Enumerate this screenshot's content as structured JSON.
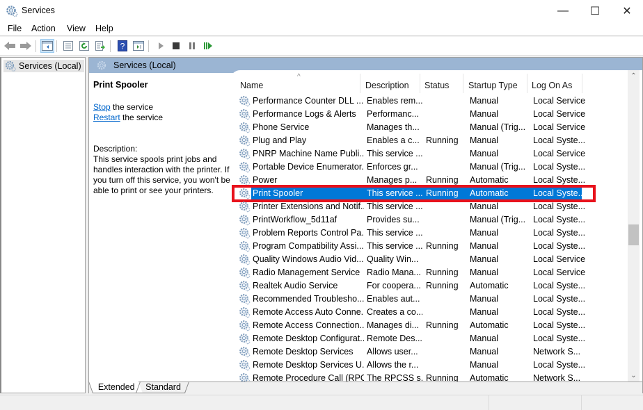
{
  "window": {
    "title": "Services",
    "controls": {
      "minimize": "—",
      "maximize": "☐",
      "close": "✕"
    }
  },
  "menu": [
    "File",
    "Action",
    "View",
    "Help"
  ],
  "toolbar": {
    "icons": [
      "back-icon",
      "forward-icon",
      "show-hide-console-tree-icon",
      "properties-icon",
      "refresh-icon",
      "export-list-icon",
      "help-icon",
      "show-hide-action-pane-icon",
      "start-service-icon",
      "stop-service-icon",
      "pause-service-icon",
      "resume-service-icon"
    ]
  },
  "tree": {
    "root": "Services (Local)"
  },
  "main": {
    "header": "Services (Local)",
    "details": {
      "service_name": "Print Spooler",
      "stop_link": "Stop",
      "stop_suffix": " the service",
      "restart_link": "Restart",
      "restart_suffix": " the service",
      "description_label": "Description:",
      "description": "This service spools print jobs and handles interaction with the printer. If you turn off this service, you won't be able to print or see your printers."
    },
    "columns": [
      "Name",
      "Description",
      "Status",
      "Startup Type",
      "Log On As"
    ],
    "sort_indicator": "^",
    "rows": [
      {
        "name": "Performance Counter DLL ...",
        "description": "Enables rem...",
        "status": "",
        "startup": "Manual",
        "logon": "Local Service"
      },
      {
        "name": "Performance Logs & Alerts",
        "description": "Performanc...",
        "status": "",
        "startup": "Manual",
        "logon": "Local Service"
      },
      {
        "name": "Phone Service",
        "description": "Manages th...",
        "status": "",
        "startup": "Manual (Trig...",
        "logon": "Local Service"
      },
      {
        "name": "Plug and Play",
        "description": "Enables a c...",
        "status": "Running",
        "startup": "Manual",
        "logon": "Local Syste..."
      },
      {
        "name": "PNRP Machine Name Publi...",
        "description": "This service ...",
        "status": "",
        "startup": "Manual",
        "logon": "Local Service"
      },
      {
        "name": "Portable Device Enumerator...",
        "description": "Enforces gr...",
        "status": "",
        "startup": "Manual (Trig...",
        "logon": "Local Syste..."
      },
      {
        "name": "Power",
        "description": "Manages p...",
        "status": "Running",
        "startup": "Automatic",
        "logon": "Local Syste..."
      },
      {
        "name": "Print Spooler",
        "description": "This service ...",
        "status": "Running",
        "startup": "Automatic",
        "logon": "Local Syste...",
        "selected": true
      },
      {
        "name": "Printer Extensions and Notif...",
        "description": "This service ...",
        "status": "",
        "startup": "Manual",
        "logon": "Local Syste..."
      },
      {
        "name": "PrintWorkflow_5d11af",
        "description": "Provides su...",
        "status": "",
        "startup": "Manual (Trig...",
        "logon": "Local Syste..."
      },
      {
        "name": "Problem Reports Control Pa...",
        "description": "This service ...",
        "status": "",
        "startup": "Manual",
        "logon": "Local Syste..."
      },
      {
        "name": "Program Compatibility Assi...",
        "description": "This service ...",
        "status": "Running",
        "startup": "Manual",
        "logon": "Local Syste..."
      },
      {
        "name": "Quality Windows Audio Vid...",
        "description": "Quality Win...",
        "status": "",
        "startup": "Manual",
        "logon": "Local Service"
      },
      {
        "name": "Radio Management Service",
        "description": "Radio Mana...",
        "status": "Running",
        "startup": "Manual",
        "logon": "Local Service"
      },
      {
        "name": "Realtek Audio Service",
        "description": "For coopera...",
        "status": "Running",
        "startup": "Automatic",
        "logon": "Local Syste..."
      },
      {
        "name": "Recommended Troublesho...",
        "description": "Enables aut...",
        "status": "",
        "startup": "Manual",
        "logon": "Local Syste..."
      },
      {
        "name": "Remote Access Auto Conne...",
        "description": "Creates a co...",
        "status": "",
        "startup": "Manual",
        "logon": "Local Syste..."
      },
      {
        "name": "Remote Access Connection...",
        "description": "Manages di...",
        "status": "Running",
        "startup": "Automatic",
        "logon": "Local Syste..."
      },
      {
        "name": "Remote Desktop Configurat...",
        "description": "Remote Des...",
        "status": "",
        "startup": "Manual",
        "logon": "Local Syste..."
      },
      {
        "name": "Remote Desktop Services",
        "description": "Allows user...",
        "status": "",
        "startup": "Manual",
        "logon": "Network S..."
      },
      {
        "name": "Remote Desktop Services U...",
        "description": "Allows the r...",
        "status": "",
        "startup": "Manual",
        "logon": "Local Syste..."
      },
      {
        "name": "Remote Procedure Call (RPC)",
        "description": "The RPCSS s...",
        "status": "Running",
        "startup": "Automatic",
        "logon": "Network S..."
      }
    ],
    "tabs": [
      "Extended",
      "Standard"
    ]
  },
  "colors": {
    "selection": "#0078d7",
    "highlight_box": "#e8121c",
    "header_band": "#9bb5d3",
    "link": "#0066cc"
  }
}
